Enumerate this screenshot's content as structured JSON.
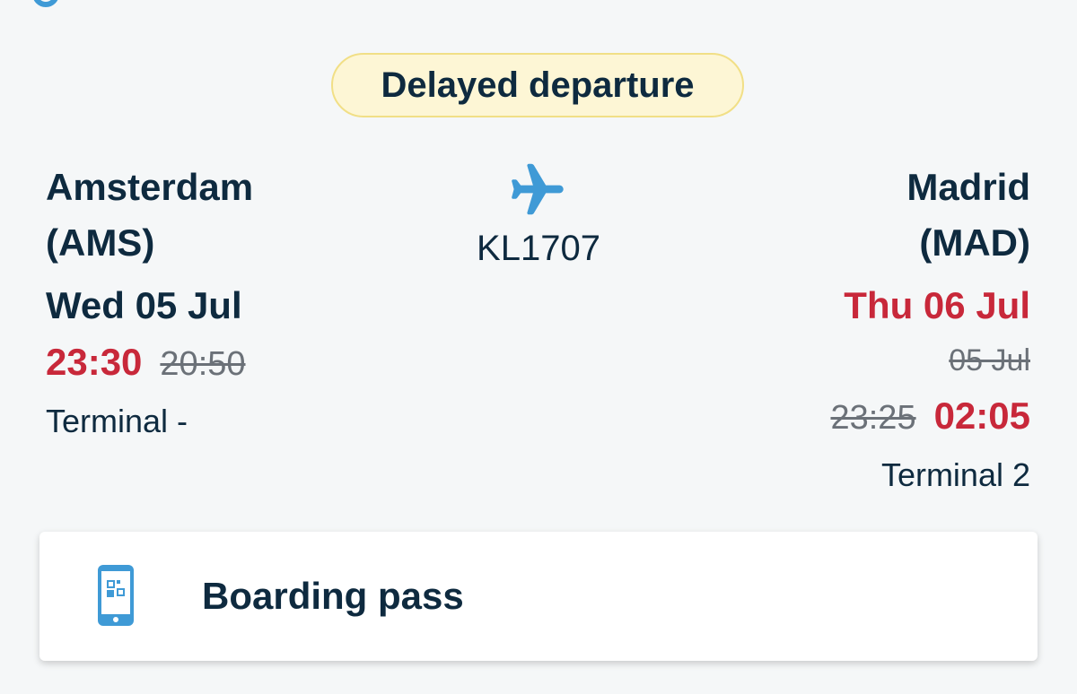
{
  "status": {
    "label": "Delayed departure"
  },
  "flight": {
    "number": "KL1707"
  },
  "origin": {
    "city": "Amsterdam",
    "code": "(AMS)",
    "date": "Wed 05 Jul",
    "time_new": "23:30",
    "time_old": "20:50",
    "terminal": "Terminal -"
  },
  "destination": {
    "city": "Madrid",
    "code": "(MAD)",
    "date": "Thu 06 Jul",
    "date_old": "05 Jul",
    "time_old": "23:25",
    "time_new": "02:05",
    "terminal": "Terminal 2"
  },
  "boarding_pass": {
    "label": "Boarding pass"
  },
  "colors": {
    "accent": "#3f9ad6",
    "delay_red": "#c8283a",
    "badge_bg": "#fdf6d5",
    "text_dark": "#0e2a3f"
  },
  "icons": {
    "flight": "airplane-icon",
    "boarding_pass": "mobile-boarding-pass-icon"
  }
}
